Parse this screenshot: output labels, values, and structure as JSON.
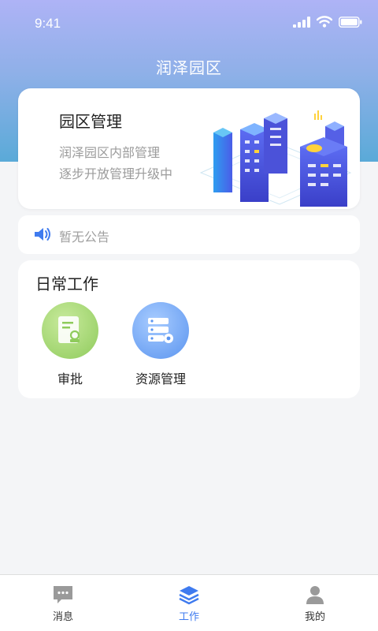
{
  "status": {
    "time": "9:41"
  },
  "header": {
    "title": "润泽园区"
  },
  "banner": {
    "title": "园区管理",
    "desc_line1": "润泽园区内部管理",
    "desc_line2": "逐步开放管理升级中"
  },
  "notice": {
    "text": "暂无公告",
    "icon": "speaker-icon"
  },
  "daily_work": {
    "title": "日常工作",
    "items": [
      {
        "label": "审批",
        "icon": "approval-document-icon",
        "color": "#9bd16a"
      },
      {
        "label": "资源管理",
        "icon": "server-settings-icon",
        "color": "#5f9bf0"
      }
    ]
  },
  "tabbar": {
    "active_color": "#3f7bef",
    "items": [
      {
        "label": "消息",
        "icon": "chat-bubble-icon"
      },
      {
        "label": "工作",
        "icon": "layers-icon",
        "active": true
      },
      {
        "label": "我的",
        "icon": "person-icon"
      }
    ]
  }
}
